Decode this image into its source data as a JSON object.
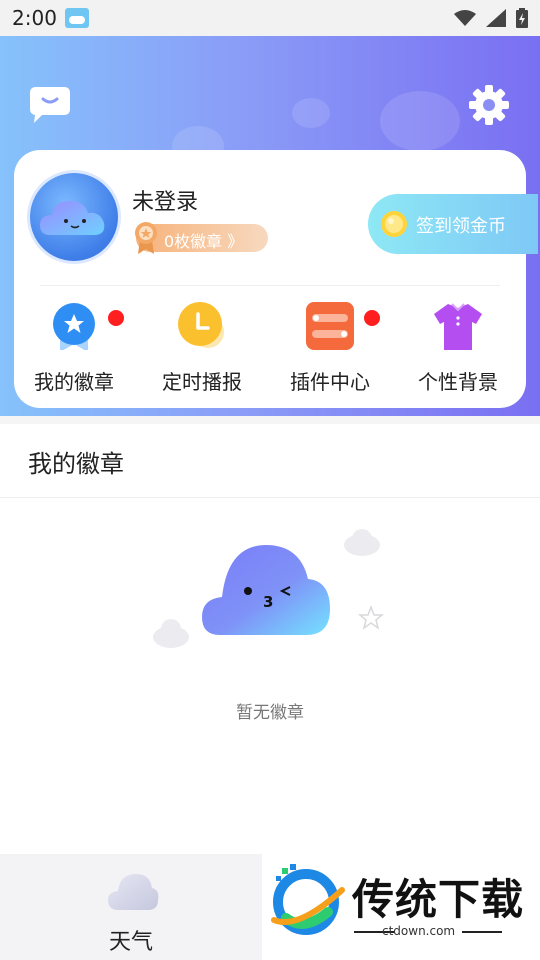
{
  "status_bar": {
    "time": "2:00",
    "icons": [
      "weather-notification-icon",
      "wifi-icon",
      "signal-icon",
      "battery-icon"
    ]
  },
  "header": {
    "icons": [
      "message-icon",
      "gear-icon"
    ]
  },
  "profile": {
    "username": "未登录",
    "badge_count_label": "0枚徽章 》",
    "signin_label": "签到领金币"
  },
  "features": [
    {
      "label": "我的徽章",
      "icon": "badge-icon",
      "red_dot": true
    },
    {
      "label": "定时播报",
      "icon": "clock-icon",
      "red_dot": false
    },
    {
      "label": "插件中心",
      "icon": "plugin-icon",
      "red_dot": true
    },
    {
      "label": "个性背景",
      "icon": "shirt-icon",
      "red_dot": false
    }
  ],
  "badges_section": {
    "title": "我的徽章",
    "empty_text": "暂无徽章"
  },
  "bottom_nav": {
    "weather_label": "天气",
    "brand_title": "传统下载",
    "brand_url": "ctdown.com"
  },
  "colors": {
    "header_gradient_start": "#86c2fb",
    "header_gradient_end": "#7a6ff2",
    "red_dot": "#ff1f1f",
    "signin_bg": "#8ee8f5",
    "badge_pill": "#f7b27a"
  }
}
